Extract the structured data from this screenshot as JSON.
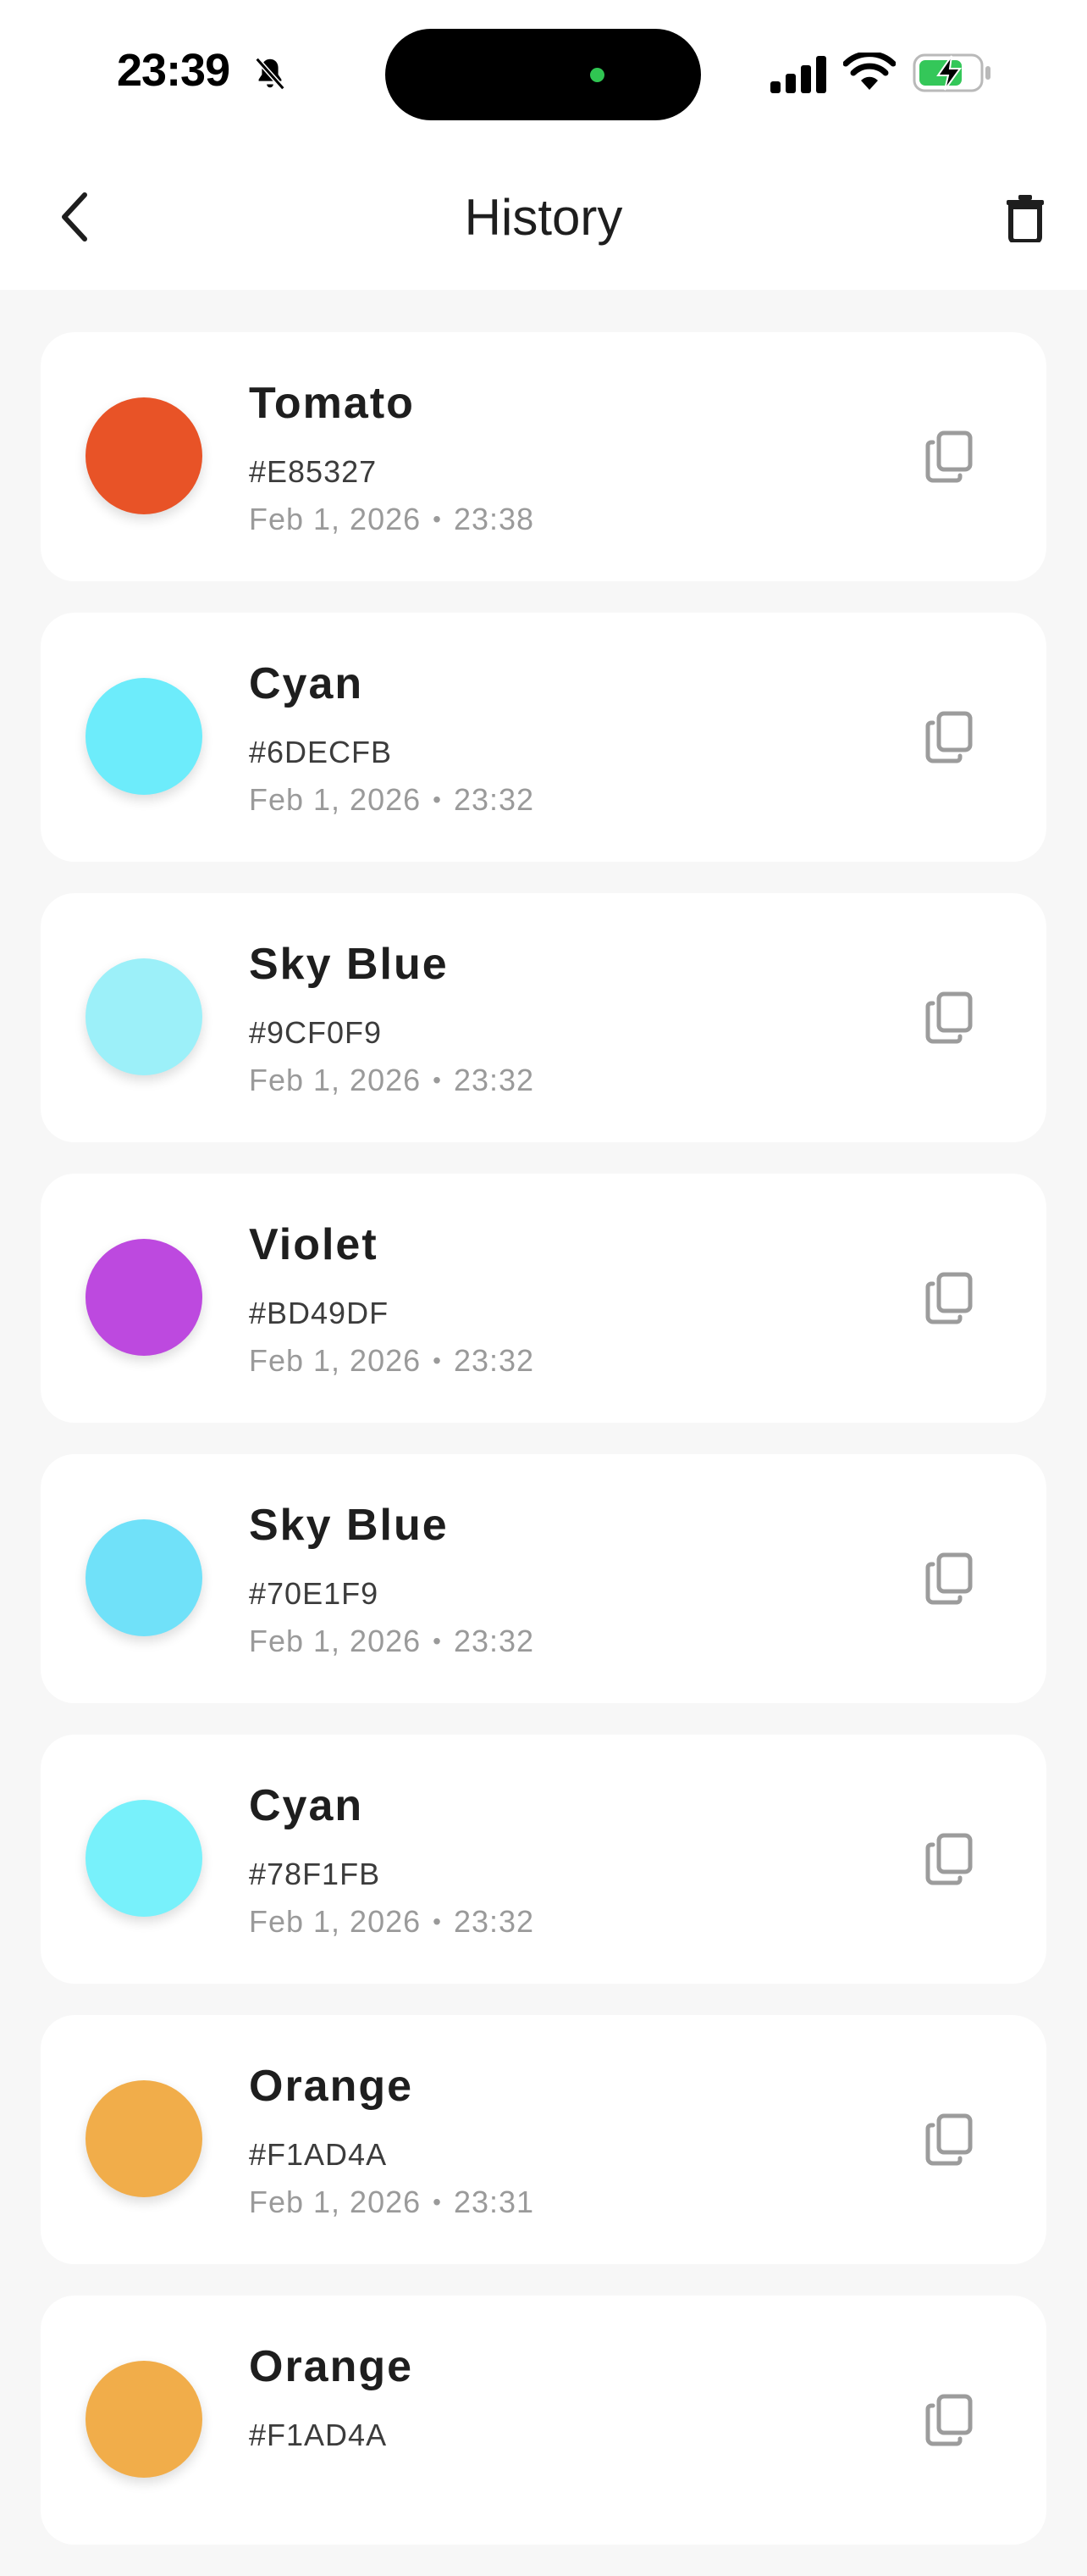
{
  "status_bar": {
    "time": "23:39",
    "icons": [
      "bell-slash-icon",
      "signal-icon",
      "wifi-icon",
      "battery-charging-icon"
    ]
  },
  "nav": {
    "title": "History",
    "back_icon": "chevron-left-icon",
    "clear_icon": "trash-icon"
  },
  "history": [
    {
      "name": "Tomato",
      "hex": "#E85327",
      "date": "Feb 1, 2026",
      "time": "23:38"
    },
    {
      "name": "Cyan",
      "hex": "#6DECFB",
      "date": "Feb 1, 2026",
      "time": "23:32"
    },
    {
      "name": "Sky Blue",
      "hex": "#9CF0F9",
      "date": "Feb 1, 2026",
      "time": "23:32"
    },
    {
      "name": "Violet",
      "hex": "#BD49DF",
      "date": "Feb 1, 2026",
      "time": "23:32"
    },
    {
      "name": "Sky Blue",
      "hex": "#70E1F9",
      "date": "Feb 1, 2026",
      "time": "23:32"
    },
    {
      "name": "Cyan",
      "hex": "#78F1FB",
      "date": "Feb 1, 2026",
      "time": "23:32"
    },
    {
      "name": "Orange",
      "hex": "#F1AD4A",
      "date": "Feb 1, 2026",
      "time": "23:31"
    },
    {
      "name": "Orange",
      "hex": "#F1AD4A",
      "date": "",
      "time": ""
    }
  ],
  "separator": "•",
  "colors": {
    "background": "#F7F7F7",
    "card": "#FFFFFF",
    "text_primary": "#1E1E1E",
    "text_secondary": "#9A9A9A",
    "battery_green": "#34C759"
  }
}
